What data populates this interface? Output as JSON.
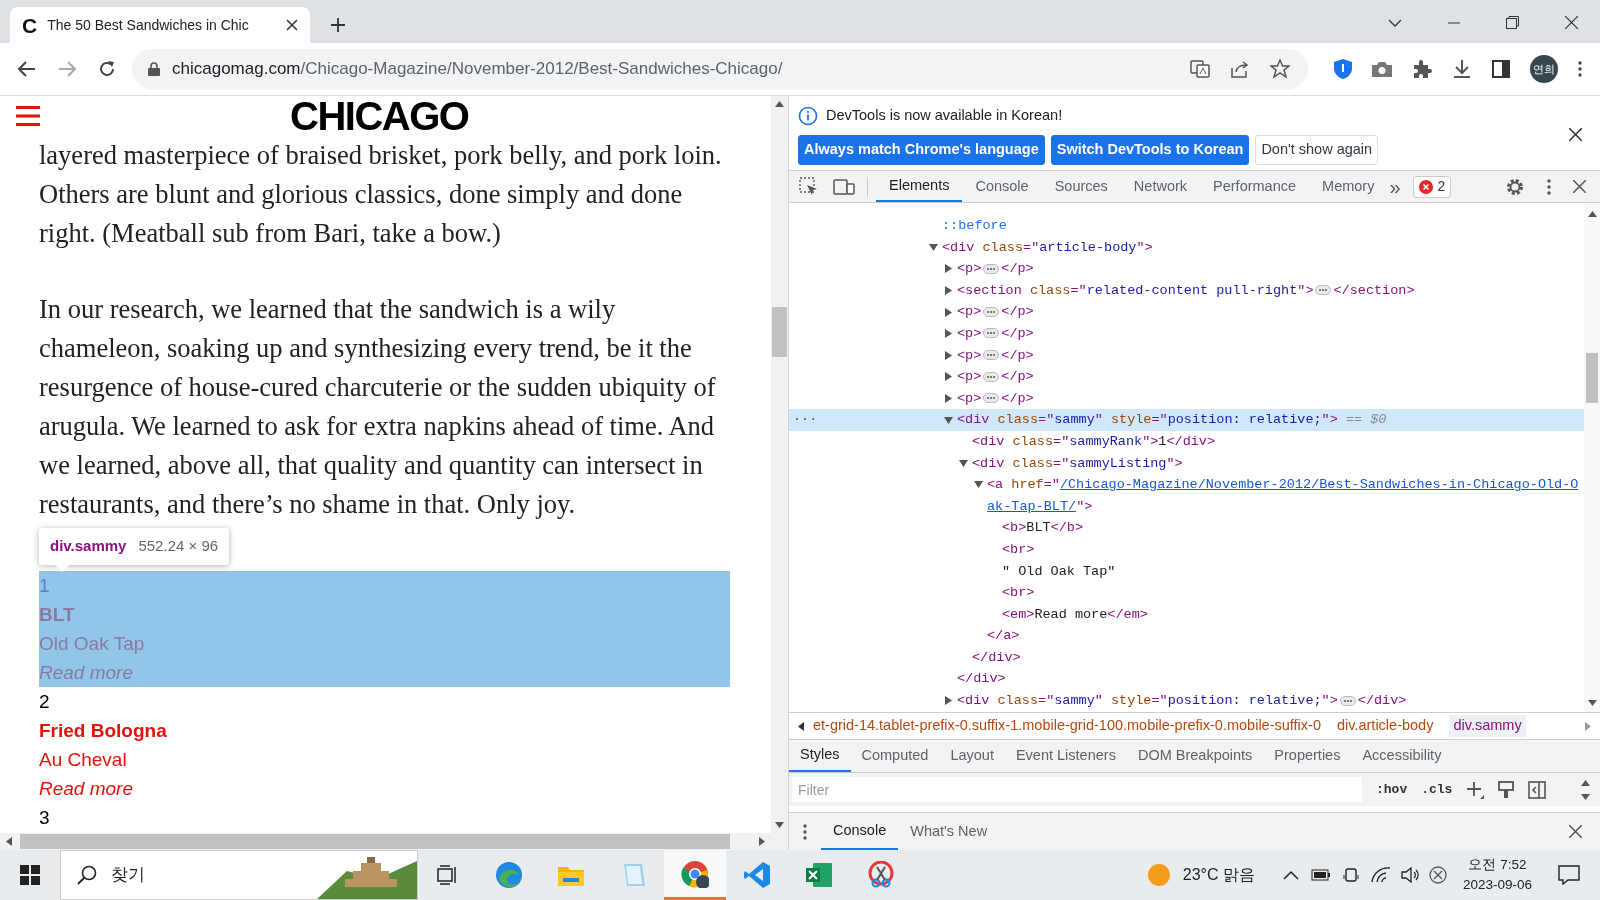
{
  "browser": {
    "favicon": "C",
    "tab_title": "The 50 Best Sandwiches in Chic",
    "url_domain": "chicagomag.com",
    "url_path": "/Chicago-Magazine/November-2012/Best-Sandwiches-Chicago/",
    "profile": "연희"
  },
  "page": {
    "logo": "CHICAGO",
    "paragraphs": [
      "layered masterpiece of braised brisket, pork belly, and pork loin. Others are blunt and glorious classics, done simply and done right. (Meatball sub from Bari, take a bow.)",
      "In our research, we learned that the sandwich is a wily chameleon, soaking up and synthesizing every trend, be it the resurgence of house-cured charcuterie or the sudden ubiquity of arugula. We learned to ask for extra napkins ahead of time. And we learned, above all, that quality and quantity can intersect in restaurants, and there’s no shame in that. Only joy."
    ],
    "tooltip": {
      "selector": "div.sammy",
      "size": "552.24 × 96"
    },
    "sammies": [
      {
        "rank": "1",
        "name": "BLT",
        "place": "Old Oak Tap",
        "link": "Read more",
        "selected": true
      },
      {
        "rank": "2",
        "name": "Fried Bologna",
        "place": "Au Cheval",
        "link": "Read more",
        "selected": false
      },
      {
        "rank": "3",
        "selected": false
      }
    ]
  },
  "devtools": {
    "infobar": {
      "message": "DevTools is now available in Korean!",
      "buttons": [
        {
          "label": "Always match Chrome's language",
          "kind": "primary"
        },
        {
          "label": "Switch DevTools to Korean",
          "kind": "primary"
        },
        {
          "label": "Don't show again",
          "kind": "secondary"
        }
      ]
    },
    "tabs": [
      {
        "label": "Elements",
        "selected": true
      },
      {
        "label": "Console",
        "selected": false
      },
      {
        "label": "Sources",
        "selected": false
      },
      {
        "label": "Network",
        "selected": false
      },
      {
        "label": "Performance",
        "selected": false
      },
      {
        "label": "Memory",
        "selected": false
      }
    ],
    "more_tabs": "»",
    "error_count": "2",
    "dom_tree": [
      {
        "selected": false,
        "segments": [
          {
            "kind": "pseudo",
            "text": "::before"
          }
        ]
      },
      {
        "selected": false,
        "expanded": true,
        "segments": [
          {
            "kind": "tag",
            "text": "<div "
          },
          {
            "kind": "attr",
            "text": "class"
          },
          {
            "kind": "tag",
            "text": "=\""
          },
          {
            "kind": "val",
            "text": "article-body"
          },
          {
            "kind": "tag",
            "text": "\">"
          }
        ],
        "children": [
          {
            "selected": false,
            "expanded": false,
            "segments": [
              {
                "kind": "tag",
                "text": "<p>"
              },
              {
                "kind": "dots"
              },
              {
                "kind": "tag",
                "text": "</p>"
              }
            ]
          },
          {
            "selected": false,
            "expanded": false,
            "segments": [
              {
                "kind": "tag",
                "text": "<section "
              },
              {
                "kind": "attr",
                "text": "class"
              },
              {
                "kind": "tag",
                "text": "=\""
              },
              {
                "kind": "val",
                "text": "related-content pull-right"
              },
              {
                "kind": "tag",
                "text": "\">"
              },
              {
                "kind": "dots"
              },
              {
                "kind": "tag",
                "text": "</section>"
              }
            ]
          },
          {
            "selected": false,
            "expanded": false,
            "segments": [
              {
                "kind": "tag",
                "text": "<p>"
              },
              {
                "kind": "dots"
              },
              {
                "kind": "tag",
                "text": "</p>"
              }
            ]
          },
          {
            "selected": false,
            "expanded": false,
            "segments": [
              {
                "kind": "tag",
                "text": "<p>"
              },
              {
                "kind": "dots"
              },
              {
                "kind": "tag",
                "text": "</p>"
              }
            ]
          },
          {
            "selected": false,
            "expanded": false,
            "segments": [
              {
                "kind": "tag",
                "text": "<p>"
              },
              {
                "kind": "dots"
              },
              {
                "kind": "tag",
                "text": "</p>"
              }
            ]
          },
          {
            "selected": false,
            "expanded": false,
            "segments": [
              {
                "kind": "tag",
                "text": "<p>"
              },
              {
                "kind": "dots"
              },
              {
                "kind": "tag",
                "text": "</p>"
              }
            ]
          },
          {
            "selected": false,
            "expanded": false,
            "segments": [
              {
                "kind": "tag",
                "text": "<p>"
              },
              {
                "kind": "dots"
              },
              {
                "kind": "tag",
                "text": "</p>"
              }
            ]
          },
          {
            "selected": true,
            "expanded": true,
            "gutter": "···",
            "segments": [
              {
                "kind": "tag",
                "text": "<div "
              },
              {
                "kind": "attr",
                "text": "class"
              },
              {
                "kind": "tag",
                "text": "=\""
              },
              {
                "kind": "val",
                "text": "sammy"
              },
              {
                "kind": "tag",
                "text": "\" "
              },
              {
                "kind": "attr",
                "text": "style"
              },
              {
                "kind": "tag",
                "text": "=\""
              },
              {
                "kind": "val",
                "text": "position: relative;"
              },
              {
                "kind": "tag",
                "text": "\">"
              },
              {
                "kind": "dim",
                "text": " == $0"
              }
            ],
            "children": [
              {
                "selected": false,
                "segments": [
                  {
                    "kind": "tag",
                    "text": "<div "
                  },
                  {
                    "kind": "attr",
                    "text": "class"
                  },
                  {
                    "kind": "tag",
                    "text": "=\""
                  },
                  {
                    "kind": "val",
                    "text": "sammyRank"
                  },
                  {
                    "kind": "tag",
                    "text": "\">"
                  },
                  {
                    "kind": "text",
                    "text": "1"
                  },
                  {
                    "kind": "tag",
                    "text": "</div>"
                  }
                ]
              },
              {
                "selected": false,
                "expanded": true,
                "segments": [
                  {
                    "kind": "tag",
                    "text": "<div "
                  },
                  {
                    "kind": "attr",
                    "text": "class"
                  },
                  {
                    "kind": "tag",
                    "text": "=\""
                  },
                  {
                    "kind": "val",
                    "text": "sammyListing"
                  },
                  {
                    "kind": "tag",
                    "text": "\">"
                  }
                ],
                "children": [
                  {
                    "selected": false,
                    "expanded": true,
                    "segments": [
                      {
                        "kind": "tag",
                        "text": "<a "
                      },
                      {
                        "kind": "attr",
                        "text": "href"
                      },
                      {
                        "kind": "tag",
                        "text": "=\""
                      },
                      {
                        "kind": "link",
                        "text": "/Chicago-Magazine/November-2012/Best-Sandwiches-in-Chicago-Old-Oak-Tap-BLT/"
                      },
                      {
                        "kind": "tag",
                        "text": "\">"
                      }
                    ],
                    "children": [
                      {
                        "selected": false,
                        "segments": [
                          {
                            "kind": "tag",
                            "text": "<b>"
                          },
                          {
                            "kind": "text",
                            "text": "BLT"
                          },
                          {
                            "kind": "tag",
                            "text": "</b>"
                          }
                        ]
                      },
                      {
                        "selected": false,
                        "segments": [
                          {
                            "kind": "tag",
                            "text": "<br>"
                          }
                        ]
                      },
                      {
                        "selected": false,
                        "segments": [
                          {
                            "kind": "text",
                            "text": "\" Old Oak Tap\""
                          }
                        ]
                      },
                      {
                        "selected": false,
                        "segments": [
                          {
                            "kind": "tag",
                            "text": "<br>"
                          }
                        ]
                      },
                      {
                        "selected": false,
                        "segments": [
                          {
                            "kind": "tag",
                            "text": "<em>"
                          },
                          {
                            "kind": "text",
                            "text": "Read more"
                          },
                          {
                            "kind": "tag",
                            "text": "</em>"
                          }
                        ]
                      }
                    ],
                    "closing": "</a>"
                  }
                ],
                "closing": "</div>"
              }
            ],
            "closing": "</div>"
          },
          {
            "selected": false,
            "expanded": false,
            "segments": [
              {
                "kind": "tag",
                "text": "<div "
              },
              {
                "kind": "attr",
                "text": "class"
              },
              {
                "kind": "tag",
                "text": "=\""
              },
              {
                "kind": "val",
                "text": "sammy"
              },
              {
                "kind": "tag",
                "text": "\" "
              },
              {
                "kind": "attr",
                "text": "style"
              },
              {
                "kind": "tag",
                "text": "=\""
              },
              {
                "kind": "val",
                "text": "position: relative;"
              },
              {
                "kind": "tag",
                "text": "\">"
              },
              {
                "kind": "dots"
              },
              {
                "kind": "tag",
                "text": "</div>"
              }
            ]
          }
        ]
      }
    ],
    "breadcrumbs": [
      {
        "label": "et-grid-14.tablet-prefix-0.suffix-1.mobile-grid-100.mobile-prefix-0.mobile-suffix-0",
        "selected": false
      },
      {
        "label": "div.article-body",
        "selected": false
      },
      {
        "label": "div.sammy",
        "selected": true
      }
    ],
    "lower_tabs": [
      {
        "label": "Styles",
        "selected": true
      },
      {
        "label": "Computed",
        "selected": false
      },
      {
        "label": "Layout",
        "selected": false
      },
      {
        "label": "Event Listeners",
        "selected": false
      },
      {
        "label": "DOM Breakpoints",
        "selected": false
      },
      {
        "label": "Properties",
        "selected": false
      },
      {
        "label": "Accessibility",
        "selected": false
      }
    ],
    "filter": {
      "placeholder": "Filter"
    },
    "filter_buttons": [
      ":hov",
      ".cls"
    ],
    "drawer_tabs": [
      {
        "label": "Console",
        "selected": true
      },
      {
        "label": "What's New",
        "selected": false
      }
    ]
  },
  "taskbar": {
    "search": "찾기",
    "weather": "23°C 맑음",
    "time": "오전 7:52",
    "date": "2023-09-06",
    "apps": [
      {
        "kind": "edge",
        "active": false
      },
      {
        "kind": "folder",
        "active": false
      },
      {
        "kind": "notepad",
        "active": false
      },
      {
        "kind": "chrome",
        "active": true
      },
      {
        "kind": "vscode",
        "active": false
      },
      {
        "kind": "excel",
        "active": false
      },
      {
        "kind": "snip",
        "active": false
      }
    ]
  }
}
